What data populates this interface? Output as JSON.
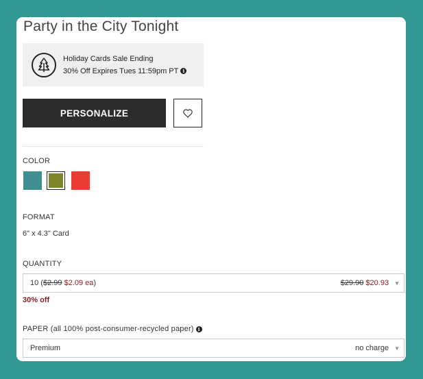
{
  "product": {
    "title": "Party in the City Tonight"
  },
  "promo": {
    "icon": "tree-icon",
    "line1": "Holiday Cards Sale Ending",
    "line2": "30% Off Expires Tues 11:59pm PT",
    "info_icon": "info-icon"
  },
  "actions": {
    "personalize_label": "PERSONALIZE",
    "favorite_icon": "heart-icon"
  },
  "color": {
    "label": "COLOR",
    "swatches": [
      {
        "name": "teal",
        "hex": "#3f8f91",
        "selected": false
      },
      {
        "name": "olive",
        "hex": "#7e8428",
        "selected": true
      },
      {
        "name": "red",
        "hex": "#ec3d34",
        "selected": false
      }
    ]
  },
  "format": {
    "label": "FORMAT",
    "value": "6\" x 4.3\" Card"
  },
  "quantity": {
    "label": "QUANTITY",
    "qty": "10",
    "old_unit": "$2.99",
    "new_unit": "$2.09 ea",
    "old_total": "$29.90",
    "new_total": "$20.93",
    "discount": "30% off"
  },
  "paper": {
    "label": "PAPER (all 100% post-consumer-recycled paper)",
    "selected": "Premium",
    "price_note": "no charge"
  }
}
